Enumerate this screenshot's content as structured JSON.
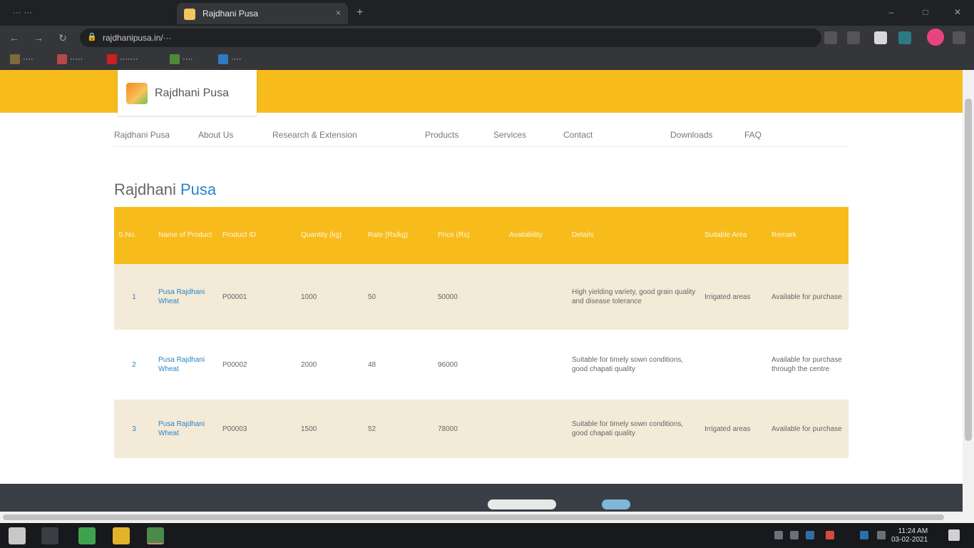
{
  "browser": {
    "left_tab_hint": "··· ···",
    "active_tab_title": "Rajdhani Pusa",
    "close_glyph": "×",
    "new_tab_glyph": "+",
    "url": "rajdhanipusa.in/···",
    "bookmarks": [
      "····",
      "·····",
      "·······",
      "····",
      "····"
    ]
  },
  "site": {
    "logo_text": "Rajdhani Pusa",
    "menu": [
      "Rajdhani Pusa",
      "About Us",
      "Research & Extension",
      "Products",
      "Services",
      "Contact",
      "Downloads",
      "FAQ"
    ]
  },
  "section": {
    "title_plain": "Rajdhani",
    "title_highlight": "Pusa"
  },
  "table": {
    "headers": [
      "S.No.",
      "Name of Product",
      "Product ID",
      "Quantity (kg)",
      "Rate (Rs/kg)",
      "Price (Rs)",
      "Availability",
      "Details",
      "Suitable Area",
      "Remark"
    ],
    "rows": [
      [
        "1",
        "Pusa Rajdhani Wheat",
        "P00001",
        "1000",
        "50",
        "50000",
        "",
        "High yielding variety, good grain quality and disease tolerance",
        "Irrigated areas",
        "Available for purchase"
      ],
      [
        "2",
        "Pusa Rajdhani Wheat",
        "P00002",
        "2000",
        "48",
        "96000",
        "",
        "Suitable for timely sown conditions, good chapati quality",
        "",
        "Available for purchase through the centre"
      ],
      [
        "3",
        "Pusa Rajdhani Wheat",
        "P00003",
        "1500",
        "52",
        "78000",
        "",
        "Suitable for timely sown conditions, good chapati quality",
        "Irrigated areas",
        "Available for purchase"
      ]
    ]
  },
  "footer": {},
  "taskbar": {
    "time": "11:24 AM",
    "date": "03-02-2021"
  }
}
